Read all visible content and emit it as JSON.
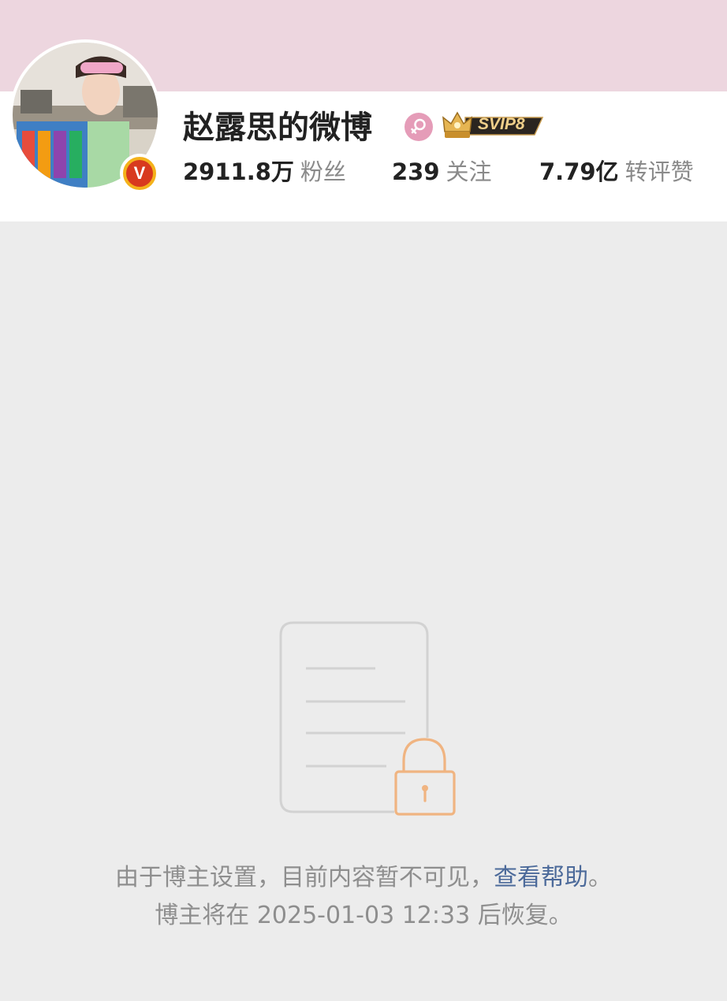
{
  "profile": {
    "username": "赵露思的微博",
    "gender_icon": "female-icon",
    "svip_label": "SVIP8",
    "verified_icon": "verified-v-icon",
    "verified_letter": "V"
  },
  "stats": {
    "fans_value": "2911.8万",
    "fans_label": "粉丝",
    "following_value": "239",
    "following_label": "关注",
    "likes_value": "7.79亿",
    "likes_label": "转评赞"
  },
  "notice": {
    "line1_prefix": "由于博主设置，目前内容暂不可见，",
    "help_link": "查看帮助",
    "line1_suffix": "。",
    "line2": "博主将在 2025-01-03 12:33 后恢复。"
  },
  "colors": {
    "cover": "#edd6df",
    "page_bg": "#ececec",
    "link": "#4c6a9a",
    "lock": "#f0b481",
    "gender_badge": "#e59cb8"
  }
}
